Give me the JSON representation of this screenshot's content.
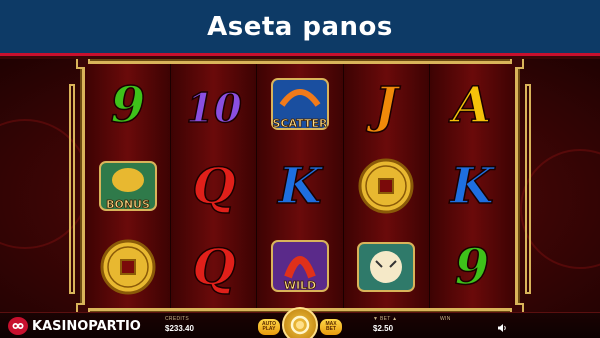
{
  "header": {
    "title": "Aseta panos"
  },
  "reels": [
    [
      {
        "symbol": "9",
        "color": "#3ec21a"
      },
      {
        "symbol": "bonus",
        "label": "BONUS"
      },
      {
        "symbol": "coin"
      }
    ],
    [
      {
        "symbol": "10",
        "color": "#8a4fe0"
      },
      {
        "symbol": "Q",
        "color": "#e0201a"
      },
      {
        "symbol": "Q",
        "color": "#e0201a"
      }
    ],
    [
      {
        "symbol": "scatter",
        "label": "SCATTER"
      },
      {
        "symbol": "K",
        "color": "#1e6fe0"
      },
      {
        "symbol": "wild",
        "label": "WILD"
      }
    ],
    [
      {
        "symbol": "J",
        "color": "#f08a0a"
      },
      {
        "symbol": "coin"
      },
      {
        "symbol": "tiger"
      }
    ],
    [
      {
        "symbol": "A",
        "color": "#f5c20a"
      },
      {
        "symbol": "K",
        "color": "#1e6fe0"
      },
      {
        "symbol": "9",
        "color": "#3ec21a"
      }
    ]
  ],
  "controls": {
    "brand": "KASINOPARTIO",
    "credits_label": "CREDITS",
    "credits_value": "$233.40",
    "autoplay_line1": "AUTO",
    "autoplay_line2": "PLAY",
    "maxbet_line1": "MAX",
    "maxbet_line2": "BET",
    "bet_label": "▼ BET ▲",
    "bet_value": "$2.50",
    "win_label": "WIN",
    "win_value": ""
  }
}
